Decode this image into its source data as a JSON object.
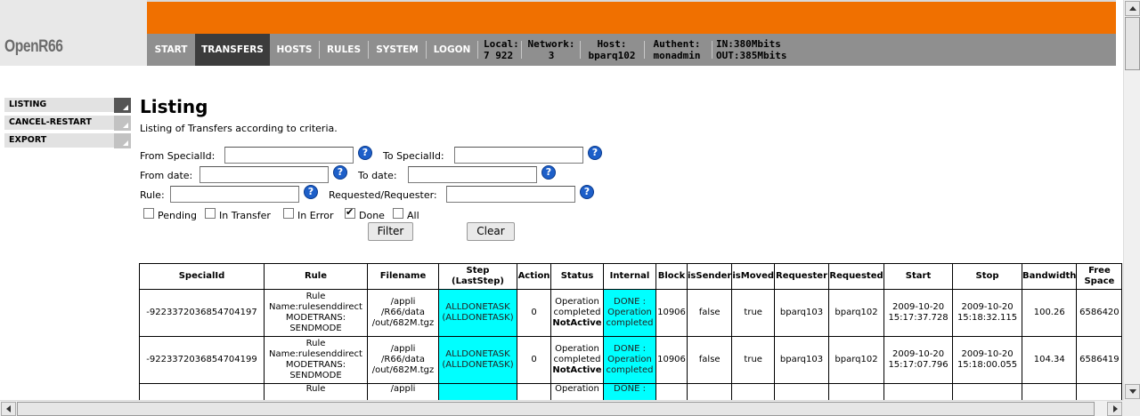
{
  "app": {
    "logo": "OpenR66"
  },
  "nav": {
    "items": [
      {
        "label": "START"
      },
      {
        "label": "TRANSFERS"
      },
      {
        "label": "HOSTS"
      },
      {
        "label": "RULES"
      },
      {
        "label": "SYSTEM"
      },
      {
        "label": "LOGON"
      }
    ],
    "stats": {
      "local_label": "Local:",
      "local_value": "7 922",
      "network_label": "Network:",
      "network_value": "3",
      "host_label": "Host:",
      "host_value": "bparq102",
      "authent_label": "Authent:",
      "authent_value": "monadmin",
      "in": "IN:380Mbits",
      "out": "OUT:385Mbits"
    }
  },
  "sidebar": {
    "items": [
      {
        "label": "LISTING"
      },
      {
        "label": "CANCEL-RESTART"
      },
      {
        "label": "EXPORT"
      }
    ]
  },
  "main": {
    "title": "Listing",
    "subtitle": "Listing of Transfers according to criteria.",
    "form": {
      "from_specialid_label": "From SpecialId:",
      "to_specialid_label": "To SpecialId:",
      "from_date_label": "From date:",
      "to_date_label": "To date:",
      "rule_label": "Rule:",
      "requested_label": "Requested/Requester:",
      "checkboxes": [
        {
          "label": "Pending",
          "checked": false
        },
        {
          "label": "In Transfer",
          "checked": false
        },
        {
          "label": "In Error",
          "checked": false
        },
        {
          "label": "Done",
          "checked": true
        },
        {
          "label": "All",
          "checked": false
        }
      ],
      "filter_label": "Filter",
      "clear_label": "Clear",
      "help_glyph": "?"
    },
    "table": {
      "headers": [
        "SpecialId",
        "Rule",
        "Filename",
        "Step (LastStep)",
        "Action",
        "Status",
        "Internal",
        "Block",
        "isSender",
        "isMoved",
        "Requester",
        "Requested",
        "Start",
        "Stop",
        "Bandwidth",
        "Free Space"
      ],
      "rows": [
        {
          "specialid": "-9223372036854704197",
          "rule": "Rule Name:rulesenddirect MODETRANS: SENDMODE",
          "filename": "/appli /R66/data /out/682M.tgz",
          "step": "ALLDONETASK (ALLDONETASK)",
          "action": "0",
          "status": "Operation completed",
          "status_bold": "NotActive",
          "internal": "DONE : Operation completed",
          "block": "10906",
          "issender": "false",
          "ismoved": "true",
          "requester": "bparq103",
          "requested": "bparq102",
          "start": "2009-10-20 15:17:37.728",
          "stop": "2009-10-20 15:18:32.115",
          "bandwidth": "100.26",
          "freespace": "6586420"
        },
        {
          "specialid": "-9223372036854704199",
          "rule": "Rule Name:rulesenddirect MODETRANS: SENDMODE",
          "filename": "/appli /R66/data /out/682M.tgz",
          "step": "ALLDONETASK (ALLDONETASK)",
          "action": "0",
          "status": "Operation completed",
          "status_bold": "NotActive",
          "internal": "DONE : Operation completed",
          "block": "10906",
          "issender": "false",
          "ismoved": "true",
          "requester": "bparq103",
          "requested": "bparq102",
          "start": "2009-10-20 15:17:07.796",
          "stop": "2009-10-20 15:18:00.055",
          "bandwidth": "104.34",
          "freespace": "6586419"
        },
        {
          "specialid": "",
          "rule": "Rule",
          "filename": "/appli",
          "step": "",
          "action": "",
          "status": "Operation",
          "status_bold": "",
          "internal": "DONE :",
          "block": "",
          "issender": "",
          "ismoved": "",
          "requester": "",
          "requested": "",
          "start": "",
          "stop": "",
          "bandwidth": "",
          "freespace": ""
        }
      ]
    }
  },
  "colors": {
    "orange": "#f07000",
    "nav_gray": "#8f8f8f",
    "nav_active": "#3c3c3c",
    "cyan": "#00ffff",
    "help_blue": "#1d5fc9"
  }
}
